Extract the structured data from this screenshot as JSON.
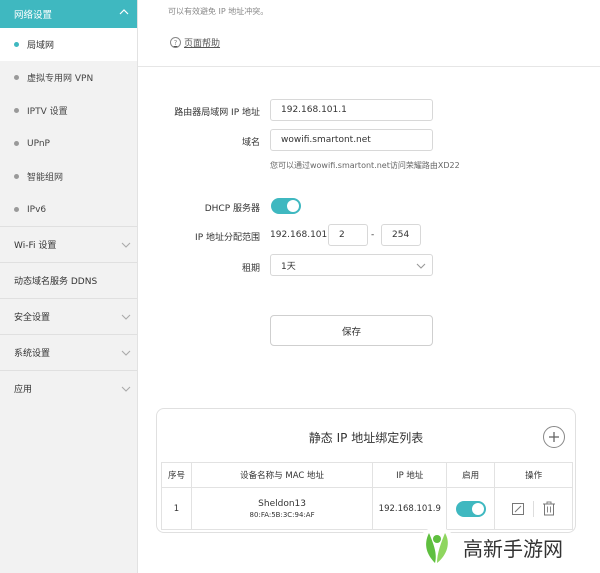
{
  "sidebar": {
    "header": "网络设置",
    "items": [
      {
        "label": "局域网",
        "active": true
      },
      {
        "label": "虚拟专用网 VPN",
        "active": false
      },
      {
        "label": "IPTV 设置",
        "active": false
      },
      {
        "label": "UPnP",
        "active": false
      },
      {
        "label": "智能组网",
        "active": false
      },
      {
        "label": "IPv6",
        "active": false
      }
    ],
    "groups": [
      {
        "label": "Wi-Fi 设置",
        "expandable": true
      },
      {
        "label": "动态域名服务 DDNS",
        "expandable": false
      },
      {
        "label": "安全设置",
        "expandable": true
      },
      {
        "label": "系统设置",
        "expandable": true
      },
      {
        "label": "应用",
        "expandable": true
      }
    ]
  },
  "main": {
    "top_note": "可以有效避免 IP 地址冲突。",
    "help_link": "页面帮助",
    "router_ip_label": "路由器局域网 IP 地址",
    "router_ip_value": "192.168.101.1",
    "domain_label": "域名",
    "domain_value": "wowifi.smartont.net",
    "domain_hint": "您可以通过wowifi.smartont.net访问荣耀路由XD22",
    "dhcp_label": "DHCP 服务器",
    "dhcp_enabled": true,
    "range_label": "IP 地址分配范围",
    "range_prefix": "192.168.101.",
    "range_start": "2",
    "range_dash": "-",
    "range_end": "254",
    "lease_label": "租期",
    "lease_value": "1天",
    "save_label": "保存"
  },
  "static_table": {
    "title": "静态 IP 地址绑定列表",
    "headers": [
      "序号",
      "设备名称与 MAC 地址",
      "IP 地址",
      "启用",
      "操作"
    ],
    "rows": [
      {
        "index": "1",
        "name": "Sheldon13",
        "mac": "80:FA:5B:3C:94:AF",
        "ip": "192.168.101.9",
        "enabled": true
      }
    ]
  },
  "watermark": {
    "text": "高新手游网"
  },
  "colors": {
    "accent": "#3fb8c0",
    "sidebar_bg": "#f2f2f2",
    "watermark_green": "#5fbf3f"
  }
}
